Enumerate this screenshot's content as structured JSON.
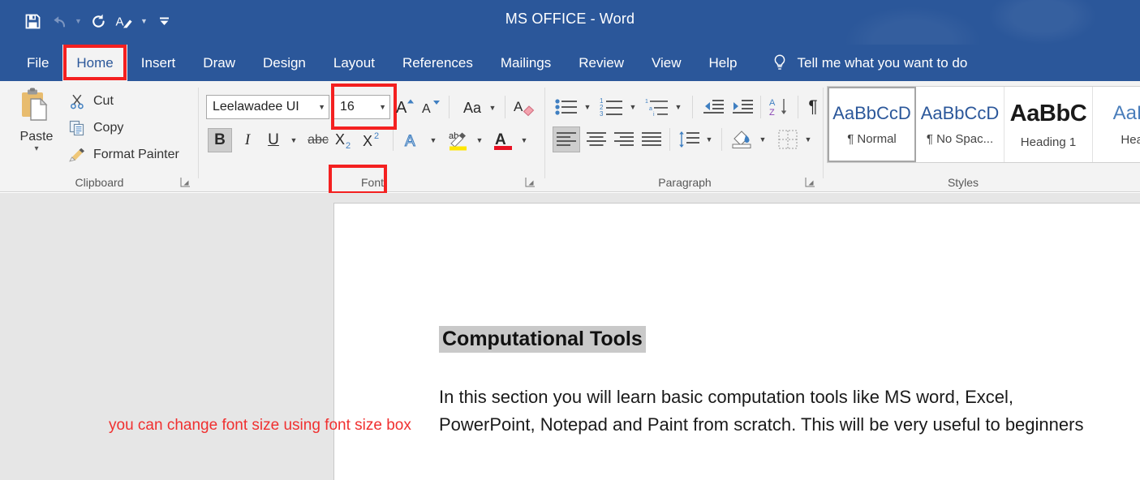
{
  "window": {
    "title_main": "MS OFFICE",
    "title_sep": "-",
    "title_app": "Word",
    "accent_color": "#2b579a",
    "highlight_color": "#f42020"
  },
  "quick_access": {
    "items": [
      {
        "name": "save-icon",
        "label": "Save",
        "has_caret": false,
        "dim": false
      },
      {
        "name": "undo-icon",
        "label": "Undo",
        "has_caret": true,
        "dim": true
      },
      {
        "name": "redo-icon",
        "label": "Redo",
        "has_caret": false,
        "dim": false
      },
      {
        "name": "format-painter-icon",
        "label": "Repeat Styles",
        "has_caret": true,
        "dim": false
      },
      {
        "name": "customize-toolbar-icon",
        "label": "Customize Quick Access Toolbar",
        "has_caret": false,
        "dim": false
      }
    ]
  },
  "tabs": [
    {
      "label": "File",
      "active": false,
      "boxed": false
    },
    {
      "label": "Home",
      "active": true,
      "boxed": true
    },
    {
      "label": "Insert",
      "active": false,
      "boxed": false
    },
    {
      "label": "Draw",
      "active": false,
      "boxed": false
    },
    {
      "label": "Design",
      "active": false,
      "boxed": false
    },
    {
      "label": "Layout",
      "active": false,
      "boxed": false
    },
    {
      "label": "References",
      "active": false,
      "boxed": false
    },
    {
      "label": "Mailings",
      "active": false,
      "boxed": false
    },
    {
      "label": "Review",
      "active": false,
      "boxed": false
    },
    {
      "label": "View",
      "active": false,
      "boxed": false
    },
    {
      "label": "Help",
      "active": false,
      "boxed": false
    }
  ],
  "tell_me": {
    "label": "Tell me what you want to do",
    "icon": "lightbulb-icon"
  },
  "ribbon": {
    "clipboard": {
      "group_label": "Clipboard",
      "paste_label": "Paste",
      "items": [
        {
          "label": "Cut",
          "icon": "scissors-icon"
        },
        {
          "label": "Copy",
          "icon": "copy-icon"
        },
        {
          "label": "Format Painter",
          "icon": "paintbrush-icon"
        }
      ]
    },
    "font": {
      "group_label": "Font",
      "group_label_boxed": true,
      "font_name": "Leelawadee UI",
      "font_size": "16",
      "font_size_boxed": true,
      "buttons_row1": [
        {
          "name": "grow-font-icon",
          "label": "A"
        },
        {
          "name": "shrink-font-icon",
          "label": "A"
        },
        {
          "name": "change-case-icon",
          "label": "Aa"
        },
        {
          "name": "clear-formatting-icon",
          "label": "A"
        }
      ],
      "buttons_row2": [
        {
          "name": "bold-button",
          "label": "B",
          "selected": true
        },
        {
          "name": "italic-button",
          "label": "I",
          "selected": false
        },
        {
          "name": "underline-button",
          "label": "U",
          "selected": false
        },
        {
          "name": "strikethrough-button",
          "label": "abc",
          "selected": false
        },
        {
          "name": "subscript-button",
          "label": "X2",
          "selected": false
        },
        {
          "name": "superscript-button",
          "label": "X2",
          "selected": false
        },
        {
          "name": "text-effects-button",
          "label": "A",
          "selected": false
        },
        {
          "name": "text-highlight-button",
          "label": "ab",
          "selected": false
        },
        {
          "name": "font-color-button",
          "label": "A",
          "selected": false
        }
      ]
    },
    "paragraph": {
      "group_label": "Paragraph",
      "buttons_row1": [
        {
          "name": "bullets-button"
        },
        {
          "name": "numbering-button"
        },
        {
          "name": "multilevel-list-button"
        },
        {
          "name": "decrease-indent-button"
        },
        {
          "name": "increase-indent-button"
        },
        {
          "name": "sort-button"
        },
        {
          "name": "show-formatting-marks-button"
        }
      ],
      "buttons_row2": [
        {
          "name": "align-left-button",
          "selected": true
        },
        {
          "name": "align-center-button",
          "selected": false
        },
        {
          "name": "align-right-button",
          "selected": false
        },
        {
          "name": "justify-button",
          "selected": false
        },
        {
          "name": "line-spacing-button",
          "selected": false
        },
        {
          "name": "shading-button",
          "selected": false
        },
        {
          "name": "borders-button",
          "selected": false
        }
      ]
    },
    "styles": {
      "group_label": "Styles",
      "gallery": [
        {
          "preview": "AaBbCcD",
          "name": "¶ Normal",
          "kind": "normal",
          "selected": true
        },
        {
          "preview": "AaBbCcD",
          "name": "¶ No Spac...",
          "kind": "normal",
          "selected": false
        },
        {
          "preview": "AaBbC",
          "name": "Heading 1",
          "kind": "h1",
          "selected": false
        },
        {
          "preview": "AaBb",
          "name": "Headi",
          "kind": "h2",
          "selected": false
        }
      ]
    }
  },
  "document": {
    "annotation": "you can change font size using font size box",
    "annotation_color": "#f03030",
    "heading": "Computational Tools",
    "heading_highlighted": true,
    "body": "In this section you will learn basic computation tools like MS word, Excel, PowerPoint, Notepad and Paint from scratch. This will be very useful to beginners"
  }
}
